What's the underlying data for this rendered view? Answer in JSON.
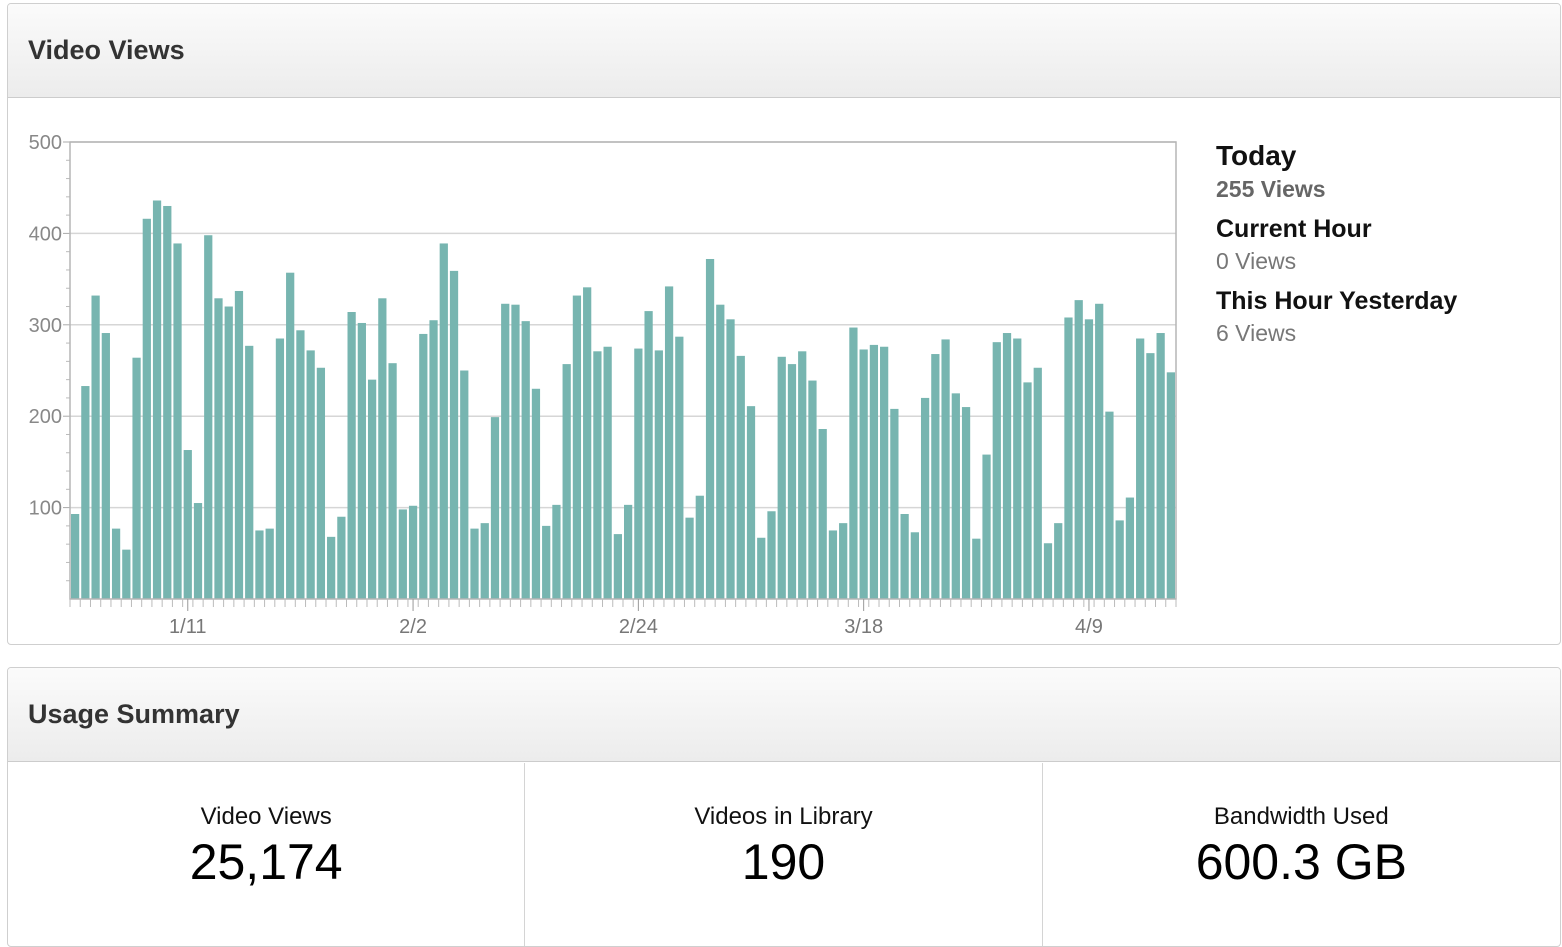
{
  "views_panel": {
    "title": "Video Views"
  },
  "stats": {
    "today_label": "Today",
    "today_value": "255 Views",
    "current_hour_label": "Current Hour",
    "current_hour_value": "0 Views",
    "yesterday_label": "This Hour Yesterday",
    "yesterday_value": "6 Views"
  },
  "usage_panel": {
    "title": "Usage Summary",
    "items": [
      {
        "label": "Video Views",
        "value": "25,174"
      },
      {
        "label": "Videos in Library",
        "value": "190"
      },
      {
        "label": "Bandwidth Used",
        "value": "600.3 GB"
      }
    ]
  },
  "chart_data": {
    "type": "bar",
    "bar_color": "#77b5b0",
    "grid": true,
    "ylim": [
      0,
      500
    ],
    "yticks": [
      100,
      200,
      300,
      400,
      500
    ],
    "xtick_labels": [
      {
        "index": 11,
        "label": "1/11"
      },
      {
        "index": 33,
        "label": "2/2"
      },
      {
        "index": 55,
        "label": "2/24"
      },
      {
        "index": 77,
        "label": "3/18"
      },
      {
        "index": 99,
        "label": "4/9"
      }
    ],
    "values": [
      93,
      233,
      332,
      291,
      77,
      54,
      264,
      416,
      436,
      430,
      389,
      163,
      105,
      398,
      329,
      320,
      337,
      277,
      75,
      77,
      285,
      357,
      294,
      272,
      253,
      68,
      90,
      314,
      302,
      240,
      329,
      258,
      98,
      102,
      290,
      305,
      389,
      359,
      250,
      77,
      83,
      199,
      323,
      322,
      304,
      230,
      80,
      103,
      257,
      332,
      341,
      271,
      276,
      71,
      103,
      274,
      315,
      272,
      342,
      287,
      89,
      113,
      372,
      322,
      306,
      266,
      211,
      67,
      96,
      265,
      257,
      271,
      239,
      186,
      75,
      83,
      297,
      273,
      278,
      276,
      208,
      93,
      73,
      220,
      268,
      284,
      225,
      210,
      66,
      158,
      281,
      291,
      285,
      237,
      253,
      61,
      83,
      308,
      327,
      306,
      323,
      205,
      86,
      111,
      285,
      269,
      291,
      248
    ]
  }
}
